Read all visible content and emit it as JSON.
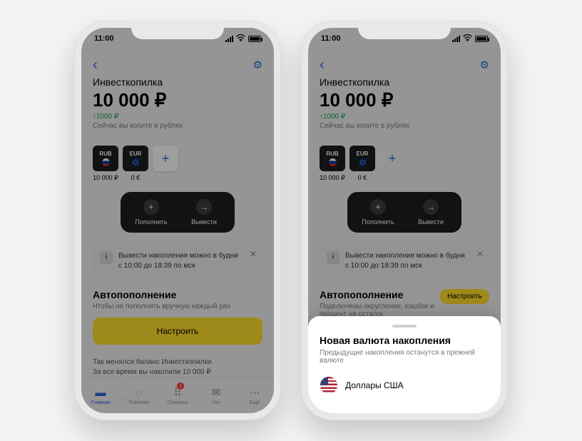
{
  "status": {
    "time": "11:00"
  },
  "page": {
    "title": "Инвесткопилка",
    "amount": "10 000 ₽",
    "delta": "↑1000 ₽",
    "subtitle": "Сейчас вы копите в рублях"
  },
  "currencies": [
    {
      "code": "RUB",
      "flag": "ru",
      "value": "10 000 ₽"
    },
    {
      "code": "EUR",
      "flag": "eu",
      "value": "0 €"
    }
  ],
  "actions": {
    "deposit": "Пополнить",
    "withdraw": "Вывести"
  },
  "info": {
    "text": "Вывести накопления можно в будни с 10:00 до 18:39 по мск"
  },
  "autoLeft": {
    "title": "Автопополнение",
    "subtitle": "Чтобы не пополнять вручную каждый раз",
    "button": "Настроить"
  },
  "autoRight": {
    "title": "Автопополнение",
    "subtitle": "Подключены округление, кэшбэк и процент на остаток",
    "badge": "Настроить"
  },
  "history": {
    "line1": "Так менялся баланс Инвесткопилки.",
    "line2": "За все время вы накопили 10 000 ₽"
  },
  "tabs": [
    {
      "label": "Главная",
      "icon": "▬",
      "active": true
    },
    {
      "label": "Платежи",
      "icon": "●"
    },
    {
      "label": "Сервисы",
      "icon": "⠿",
      "badge": "1"
    },
    {
      "label": "Чат",
      "icon": "✉"
    },
    {
      "label": "Ещё",
      "icon": "⋯"
    }
  ],
  "sheet": {
    "title": "Новая валюта накопления",
    "subtitle": "Предыдущие накопления останутся в прежней валюте",
    "option": "Доллары США"
  }
}
